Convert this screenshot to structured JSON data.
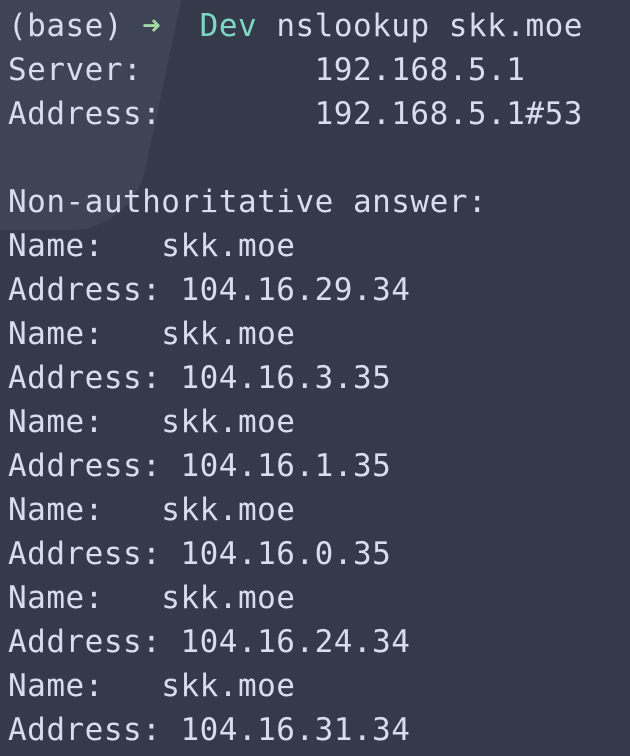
{
  "colors": {
    "background": "#353a4a",
    "text": "#d8dcee",
    "prompt_arrow": "#a3d9a5",
    "prompt_dir": "#7fd6c2"
  },
  "prompt": {
    "env": "(base)",
    "arrow_icon": "arrow-right-icon",
    "arrow": "➜",
    "directory": "Dev",
    "command": "nslookup skk.moe"
  },
  "server": {
    "server_line": "Server:         192.168.5.1",
    "address_line": "Address:        192.168.5.1#53"
  },
  "answer_header": "Non-authoritative answer:",
  "records": [
    {
      "name_line": "Name:   skk.moe",
      "address_line": "Address: 104.16.29.34"
    },
    {
      "name_line": "Name:   skk.moe",
      "address_line": "Address: 104.16.3.35"
    },
    {
      "name_line": "Name:   skk.moe",
      "address_line": "Address: 104.16.1.35"
    },
    {
      "name_line": "Name:   skk.moe",
      "address_line": "Address: 104.16.0.35"
    },
    {
      "name_line": "Name:   skk.moe",
      "address_line": "Address: 104.16.24.34"
    },
    {
      "name_line": "Name:   skk.moe",
      "address_line": "Address: 104.16.31.34"
    }
  ]
}
